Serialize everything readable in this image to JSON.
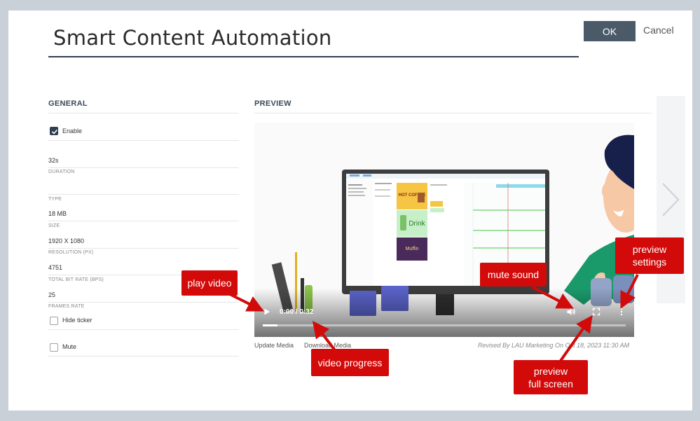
{
  "dialog": {
    "title": "Smart Content Automation",
    "ok_label": "OK",
    "cancel_label": "Cancel"
  },
  "general": {
    "heading": "GENERAL",
    "enable_label": "Enable",
    "enable_checked": true,
    "fields": [
      {
        "value": "32s",
        "label": "DURATION"
      },
      {
        "value": "",
        "label": "TYPE"
      },
      {
        "value": "18 MB",
        "label": "SIZE"
      },
      {
        "value": "1920 X 1080",
        "label": "RESOLUTION (PX)"
      },
      {
        "value": "4751",
        "label": "TOTAL BIT RATE (BPS)"
      },
      {
        "value": "25",
        "label": "FRAMES RATE"
      }
    ],
    "hide_ticker_label": "Hide ticker",
    "hide_ticker_checked": false,
    "mute_label": "Mute",
    "mute_checked": false
  },
  "preview": {
    "heading": "PREVIEW",
    "time": "0:00 / 0:32",
    "progress": 0.04,
    "update_media_label": "Update Media",
    "download_media_label": "Download Media",
    "revised_text": "Revised By LAU Marketing On Oct 18, 2023 11:30 AM",
    "next_icon": "chevron-right-icon"
  },
  "screen_content": {
    "card_1": "HOT COFFEE",
    "card_2": "Drink",
    "card_3": "Muffin"
  },
  "callouts": {
    "play_video": "play video",
    "video_progress": "video progress",
    "mute_sound": "mute sound",
    "preview_settings_line1": "preview",
    "preview_settings_line2": "settings",
    "preview_full_screen_line1": "preview",
    "preview_full_screen_line2": "full screen"
  },
  "colors": {
    "accent": "#2f4052",
    "callout": "#d20a0a",
    "ok_button": "#4b5a69"
  }
}
